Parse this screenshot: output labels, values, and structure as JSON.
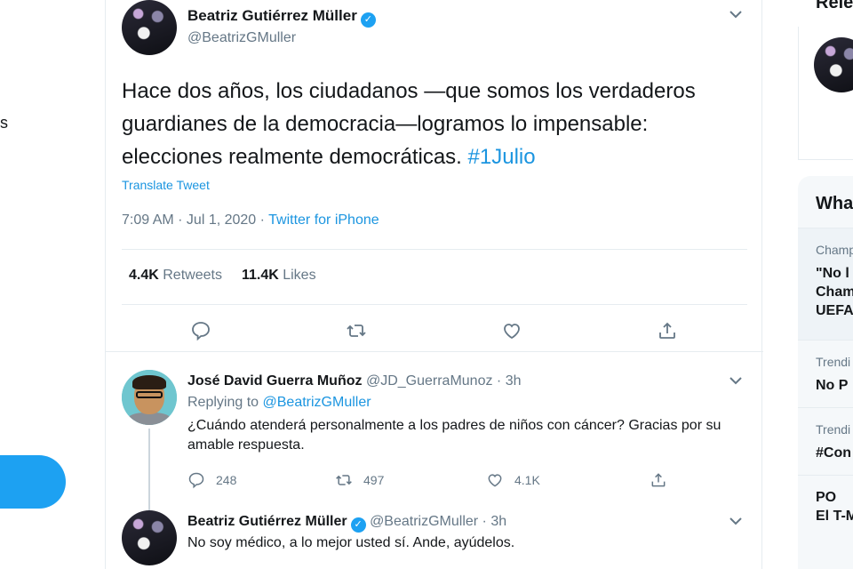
{
  "left_nav": {
    "fragment_text": "s"
  },
  "main_tweet": {
    "author_name": "Beatriz Gutiérrez Müller",
    "handle": "@BeatrizGMuller",
    "text_before": "Hace dos años, los ciudadanos —que somos los verdaderos guardianes de la democracia—logramos lo impensable: elecciones realmente democráticas. ",
    "hashtag": "#1Julio",
    "translate_label": "Translate Tweet",
    "timestamp": "7:09 AM · Jul 1, 2020 · ",
    "source": "Twitter for iPhone",
    "retweets_count": "4.4K",
    "retweets_label": "Retweets",
    "likes_count": "11.4K",
    "likes_label": "Likes"
  },
  "reply": {
    "author_name": "José David Guerra Muñoz",
    "handle_time": "@JD_GuerraMunoz · 3h",
    "replying_to_label": "Replying to ",
    "replying_to_handle": "@BeatrizGMuller",
    "text": "¿Cuándo atenderá personalmente a los padres de niños con cáncer? Gracias por su amable respuesta.",
    "reply_count": "248",
    "retweet_count": "497",
    "like_count": "4.1K"
  },
  "reply2": {
    "author_name": "Beatriz Gutiérrez Müller",
    "handle_time": "@BeatrizGMuller · 3h",
    "text": "No soy médico, a lo mejor usted sí. Ande, ayúdelos."
  },
  "right_sidebar": {
    "relevant_label": "Rele",
    "whats_happening_label": "Wha",
    "trends": [
      {
        "category": "Champ",
        "title": "\"No l\nCham\nUEFA"
      },
      {
        "category": "Trendi",
        "title": "No P"
      },
      {
        "category": "Trendi",
        "title": "#Con"
      },
      {
        "category": "",
        "title": "PO\nEl T-M"
      }
    ]
  },
  "colors": {
    "accent": "#1da1f2",
    "link": "#1b95e0",
    "muted": "#657786",
    "border": "#e6ecf0"
  },
  "icons": [
    "verified-badge-icon",
    "chevron-down-icon",
    "reply-icon",
    "retweet-icon",
    "like-icon",
    "share-icon"
  ]
}
